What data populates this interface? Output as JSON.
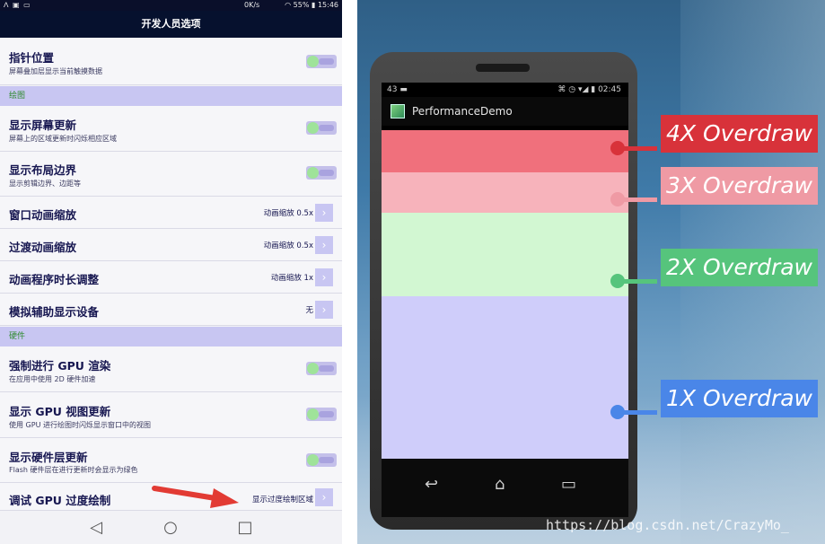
{
  "left_phone": {
    "status_bar": {
      "left_icons": "ᐱ ▣ ▭",
      "network": "0K/s",
      "battery_text": "55%",
      "time": "15:46"
    },
    "app_title": "开发人员选项",
    "rows": [
      {
        "id": "pointer",
        "title": "指针位置",
        "subtitle": "屏幕叠加层显示当前触摸数据",
        "control": "toggle"
      },
      {
        "id": "section-drawing",
        "section": "绘图"
      },
      {
        "id": "show-surface",
        "title": "显示屏幕更新",
        "subtitle": "屏幕上的区域更新时闪烁相应区域",
        "control": "toggle"
      },
      {
        "id": "layout-bounds",
        "title": "显示布局边界",
        "subtitle": "显示剪辑边界、边距等",
        "control": "toggle"
      },
      {
        "id": "window-anim",
        "title": "窗口动画缩放",
        "value": "动画缩放 0.5x",
        "control": "chevron"
      },
      {
        "id": "transition-anim",
        "title": "过渡动画缩放",
        "value": "动画缩放 0.5x",
        "control": "chevron"
      },
      {
        "id": "animator-duration",
        "title": "动画程序时长调整",
        "value": "动画缩放 1x",
        "control": "chevron"
      },
      {
        "id": "simulate-display",
        "title": "模拟辅助显示设备",
        "value": "无",
        "control": "chevron"
      },
      {
        "id": "section-hardware",
        "section": "硬件"
      },
      {
        "id": "force-gpu",
        "title": "强制进行 GPU 渲染",
        "subtitle": "在应用中使用 2D 硬件加速",
        "control": "toggle"
      },
      {
        "id": "gpu-view-updates",
        "title": "显示 GPU 视图更新",
        "subtitle": "使用 GPU 进行绘图时闪烁显示窗口中的视图",
        "control": "toggle"
      },
      {
        "id": "hw-layers",
        "title": "显示硬件层更新",
        "subtitle": "Flash 硬件层在进行更新时会显示为绿色",
        "control": "toggle"
      },
      {
        "id": "gpu-overdraw",
        "title": "调试 GPU 过度绘制",
        "value": "显示过度绘制区域",
        "control": "chevron"
      }
    ],
    "nav": {
      "back": "◁",
      "home": "○",
      "recents": "□"
    },
    "colors": {
      "toggle_on_knob": "#9fe39a",
      "section_bg": "#c8c6f2",
      "arrow": "#e23b34"
    }
  },
  "right_demo": {
    "device_status": {
      "left": "43 ▬",
      "right": "⌘ ◷ ▾◢ ▮ 02:45"
    },
    "app_title": "PerformanceDemo",
    "bands": [
      {
        "name": "4x",
        "color": "#f0707c"
      },
      {
        "name": "3x",
        "color": "#f7b3bb"
      },
      {
        "name": "2x",
        "color": "#d2f7d2"
      },
      {
        "name": "1x",
        "color": "#cfcdfa"
      }
    ],
    "labels": [
      {
        "id": "4x",
        "text": "4X Overdraw",
        "color": "#d8323a"
      },
      {
        "id": "3x",
        "text": "3X Overdraw",
        "color": "#ef9aa4"
      },
      {
        "id": "2x",
        "text": "2X Overdraw",
        "color": "#56c47c"
      },
      {
        "id": "1x",
        "text": "1X Overdraw",
        "color": "#4a86e8"
      }
    ],
    "device_nav": {
      "back": "↩",
      "home": "⌂",
      "recents": "▭"
    },
    "watermark": "https://blog.csdn.net/CrazyMo_"
  }
}
